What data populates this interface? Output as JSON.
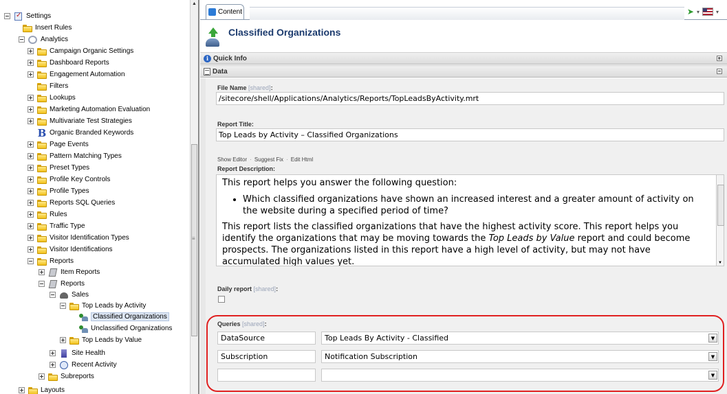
{
  "tree": {
    "settings": "Settings",
    "insert_rules": "Insert Rules",
    "analytics": "Analytics",
    "campaign": "Campaign Organic Settings",
    "dashboard": "Dashboard Reports",
    "engagement": "Engagement Automation",
    "filters": "Filters",
    "lookups": "Lookups",
    "marketing": "Marketing Automation Evaluation",
    "multivariate": "Multivariate Test Strategies",
    "organic": "Organic Branded Keywords",
    "page_events": "Page Events",
    "pattern": "Pattern Matching Types",
    "preset": "Preset Types",
    "profile_key": "Profile Key Controls",
    "profile_types": "Profile Types",
    "reports_sql": "Reports SQL Queries",
    "rules": "Rules",
    "traffic": "Traffic Type",
    "visitor_id_types": "Visitor Identification Types",
    "visitor_ids": "Visitor Identifications",
    "reports": "Reports",
    "item_reports": "Item Reports",
    "reports_sub": "Reports",
    "sales": "Sales",
    "top_leads_activity": "Top Leads by Activity",
    "classified_orgs": "Classified Organizations",
    "unclassified_orgs": "Unclassified Organizations",
    "top_leads_value": "Top Leads by Value",
    "site_health": "Site Health",
    "recent_activity": "Recent Activity",
    "subreports": "Subreports",
    "layouts": "Layouts"
  },
  "tab": {
    "label": "Content"
  },
  "item": {
    "title": "Classified Organizations",
    "icon": "up-arrow-phone-icon"
  },
  "sections": {
    "quick_info": "Quick Info",
    "data": "Data"
  },
  "fields": {
    "file_name_label": "File Name",
    "shared": "[shared]",
    "colon": ":",
    "file_name_value": "/sitecore/shell/Applications/Analytics/Reports/TopLeadsByActivity.mrt",
    "report_title_label": "Report Title:",
    "report_title_value": "Top Leads by Activity – Classified Organizations",
    "show_editor": "Show Editor",
    "suggest_fix": "Suggest Fix",
    "edit_html": "Edit Html",
    "dot": "·",
    "report_description_label": "Report Description:",
    "desc_p1": "This report helps you answer the following question:",
    "desc_li": "Which classified organizations have shown an increased interest and a greater amount of activity on the website during a specified period of time?",
    "desc_p2_a": "This report lists the classified organizations that have the highest activity score. This report helps you identify the organizations that may be moving towards the ",
    "desc_p2_em": "Top Leads by Value",
    "desc_p2_b": " report and could become prospects. The organizations listed in this report have a high level of activity, but may not have accumulated high values yet.",
    "daily_report_label": "Daily report",
    "daily_report_checked": false,
    "queries_label": "Queries"
  },
  "queries": [
    {
      "name": "DataSource",
      "value": "Top Leads By Activity - Classified"
    },
    {
      "name": "Subscription",
      "value": "Notification Subscription"
    },
    {
      "name": "",
      "value": ""
    }
  ],
  "colors": {
    "highlight": "#e02020",
    "title": "#1c3b6e"
  }
}
